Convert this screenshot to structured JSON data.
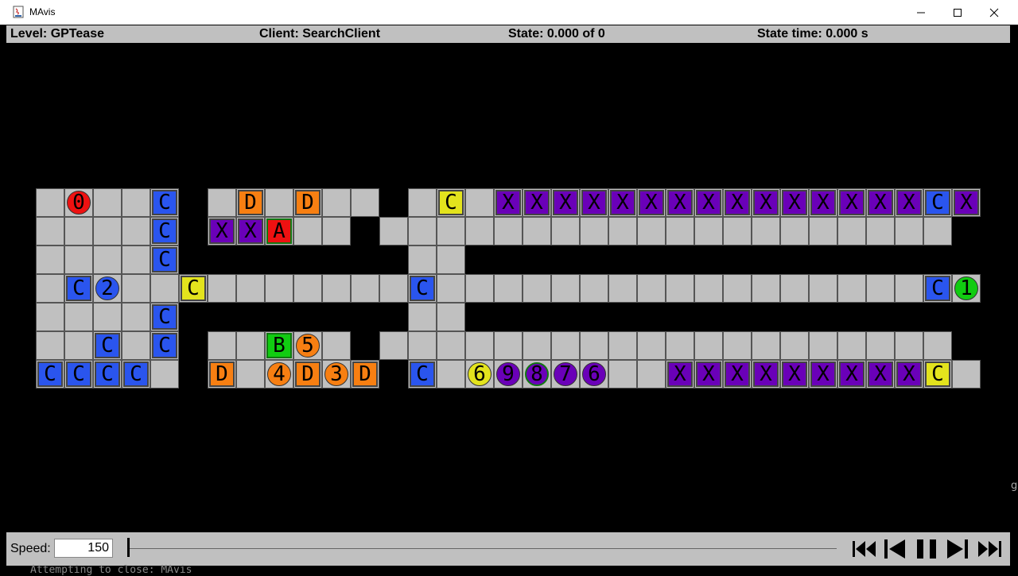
{
  "window": {
    "title": "MAvis"
  },
  "info": {
    "level": "Level: GPTease",
    "client": "Client: SearchClient",
    "state": "State: 0.000 of 0",
    "state_time": "State time: 0.000 s"
  },
  "controls": {
    "speed_label": "Speed:",
    "speed_value": "150",
    "progress": 0
  },
  "status_line": "Attempting to close: MAvis",
  "side_glyph": "g",
  "colors": {
    "floor": "#c0c0c0",
    "blue": "#2a55ee",
    "orange": "#f77f12",
    "purple": "#6a00b8",
    "yellow": "#e3e31d",
    "red": "#ee1111",
    "green": "#11cc11",
    "goal_outline": "#117711"
  },
  "boxes": [
    {
      "id": "C",
      "color": "blue",
      "col": 4,
      "row": 0
    },
    {
      "id": "C",
      "color": "blue",
      "col": 4,
      "row": 1
    },
    {
      "id": "C",
      "color": "blue",
      "col": 4,
      "row": 2
    },
    {
      "id": "C",
      "color": "blue",
      "col": 1,
      "row": 3
    },
    {
      "id": "C",
      "color": "blue",
      "col": 4,
      "row": 4
    },
    {
      "id": "C",
      "color": "blue",
      "col": 2,
      "row": 5
    },
    {
      "id": "C",
      "color": "blue",
      "col": 4,
      "row": 5
    },
    {
      "id": "C",
      "color": "blue",
      "col": 0,
      "row": 6
    },
    {
      "id": "C",
      "color": "blue",
      "col": 1,
      "row": 6
    },
    {
      "id": "C",
      "color": "blue",
      "col": 2,
      "row": 6
    },
    {
      "id": "C",
      "color": "blue",
      "col": 3,
      "row": 6
    },
    {
      "id": "C",
      "color": "yellow",
      "col": 5,
      "row": 3
    },
    {
      "id": "D",
      "color": "orange",
      "col": 7,
      "row": 0
    },
    {
      "id": "D",
      "color": "orange",
      "col": 9,
      "row": 0
    },
    {
      "id": "X",
      "color": "purple",
      "col": 6,
      "row": 1
    },
    {
      "id": "X",
      "color": "purple",
      "col": 7,
      "row": 1
    },
    {
      "id": "A",
      "color": "red",
      "col": 8,
      "row": 1,
      "goal": true
    },
    {
      "id": "B",
      "color": "green",
      "col": 8,
      "row": 5,
      "goal": true
    },
    {
      "id": "D",
      "color": "orange",
      "col": 6,
      "row": 6
    },
    {
      "id": "D",
      "color": "orange",
      "col": 9,
      "row": 6
    },
    {
      "id": "D",
      "color": "orange",
      "col": 11,
      "row": 6
    },
    {
      "id": "C",
      "color": "yellow",
      "col": 14,
      "row": 0
    },
    {
      "id": "X",
      "color": "purple",
      "col": 16,
      "row": 0
    },
    {
      "id": "X",
      "color": "purple",
      "col": 17,
      "row": 0
    },
    {
      "id": "X",
      "color": "purple",
      "col": 18,
      "row": 0
    },
    {
      "id": "X",
      "color": "purple",
      "col": 19,
      "row": 0
    },
    {
      "id": "X",
      "color": "purple",
      "col": 20,
      "row": 0
    },
    {
      "id": "X",
      "color": "purple",
      "col": 21,
      "row": 0
    },
    {
      "id": "X",
      "color": "purple",
      "col": 22,
      "row": 0
    },
    {
      "id": "X",
      "color": "purple",
      "col": 23,
      "row": 0
    },
    {
      "id": "X",
      "color": "purple",
      "col": 24,
      "row": 0
    },
    {
      "id": "X",
      "color": "purple",
      "col": 25,
      "row": 0
    },
    {
      "id": "X",
      "color": "purple",
      "col": 26,
      "row": 0
    },
    {
      "id": "X",
      "color": "purple",
      "col": 27,
      "row": 0
    },
    {
      "id": "X",
      "color": "purple",
      "col": 28,
      "row": 0
    },
    {
      "id": "X",
      "color": "purple",
      "col": 29,
      "row": 0
    },
    {
      "id": "X",
      "color": "purple",
      "col": 30,
      "row": 0
    },
    {
      "id": "C",
      "color": "blue",
      "col": 31,
      "row": 0
    },
    {
      "id": "X",
      "color": "purple",
      "col": 32,
      "row": 0
    },
    {
      "id": "C",
      "color": "blue",
      "col": 13,
      "row": 3
    },
    {
      "id": "C",
      "color": "blue",
      "col": 31,
      "row": 3
    },
    {
      "id": "C",
      "color": "blue",
      "col": 13,
      "row": 6
    },
    {
      "id": "X",
      "color": "purple",
      "col": 22,
      "row": 6
    },
    {
      "id": "X",
      "color": "purple",
      "col": 23,
      "row": 6
    },
    {
      "id": "X",
      "color": "purple",
      "col": 24,
      "row": 6
    },
    {
      "id": "X",
      "color": "purple",
      "col": 25,
      "row": 6
    },
    {
      "id": "X",
      "color": "purple",
      "col": 26,
      "row": 6
    },
    {
      "id": "X",
      "color": "purple",
      "col": 27,
      "row": 6
    },
    {
      "id": "X",
      "color": "purple",
      "col": 28,
      "row": 6
    },
    {
      "id": "X",
      "color": "purple",
      "col": 29,
      "row": 6
    },
    {
      "id": "X",
      "color": "purple",
      "col": 30,
      "row": 6
    },
    {
      "id": "C",
      "color": "yellow",
      "col": 31,
      "row": 6
    }
  ],
  "agents": [
    {
      "id": "0",
      "color": "red",
      "col": 1,
      "row": 0
    },
    {
      "id": "2",
      "color": "blue",
      "col": 2,
      "row": 3
    },
    {
      "id": "5",
      "color": "orange",
      "col": 9,
      "row": 5
    },
    {
      "id": "4",
      "color": "orange",
      "col": 8,
      "row": 6
    },
    {
      "id": "3",
      "color": "orange",
      "col": 10,
      "row": 6
    },
    {
      "id": "6",
      "color": "yellow",
      "col": 15,
      "row": 6
    },
    {
      "id": "9",
      "color": "purple",
      "col": 16,
      "row": 6
    },
    {
      "id": "8",
      "color": "purple",
      "col": 17,
      "row": 6,
      "goal": true
    },
    {
      "id": "7",
      "color": "purple",
      "col": 18,
      "row": 6
    },
    {
      "id": "6",
      "color": "purple",
      "col": 19,
      "row": 6
    },
    {
      "id": "1",
      "color": "green",
      "col": 32,
      "row": 3
    }
  ]
}
